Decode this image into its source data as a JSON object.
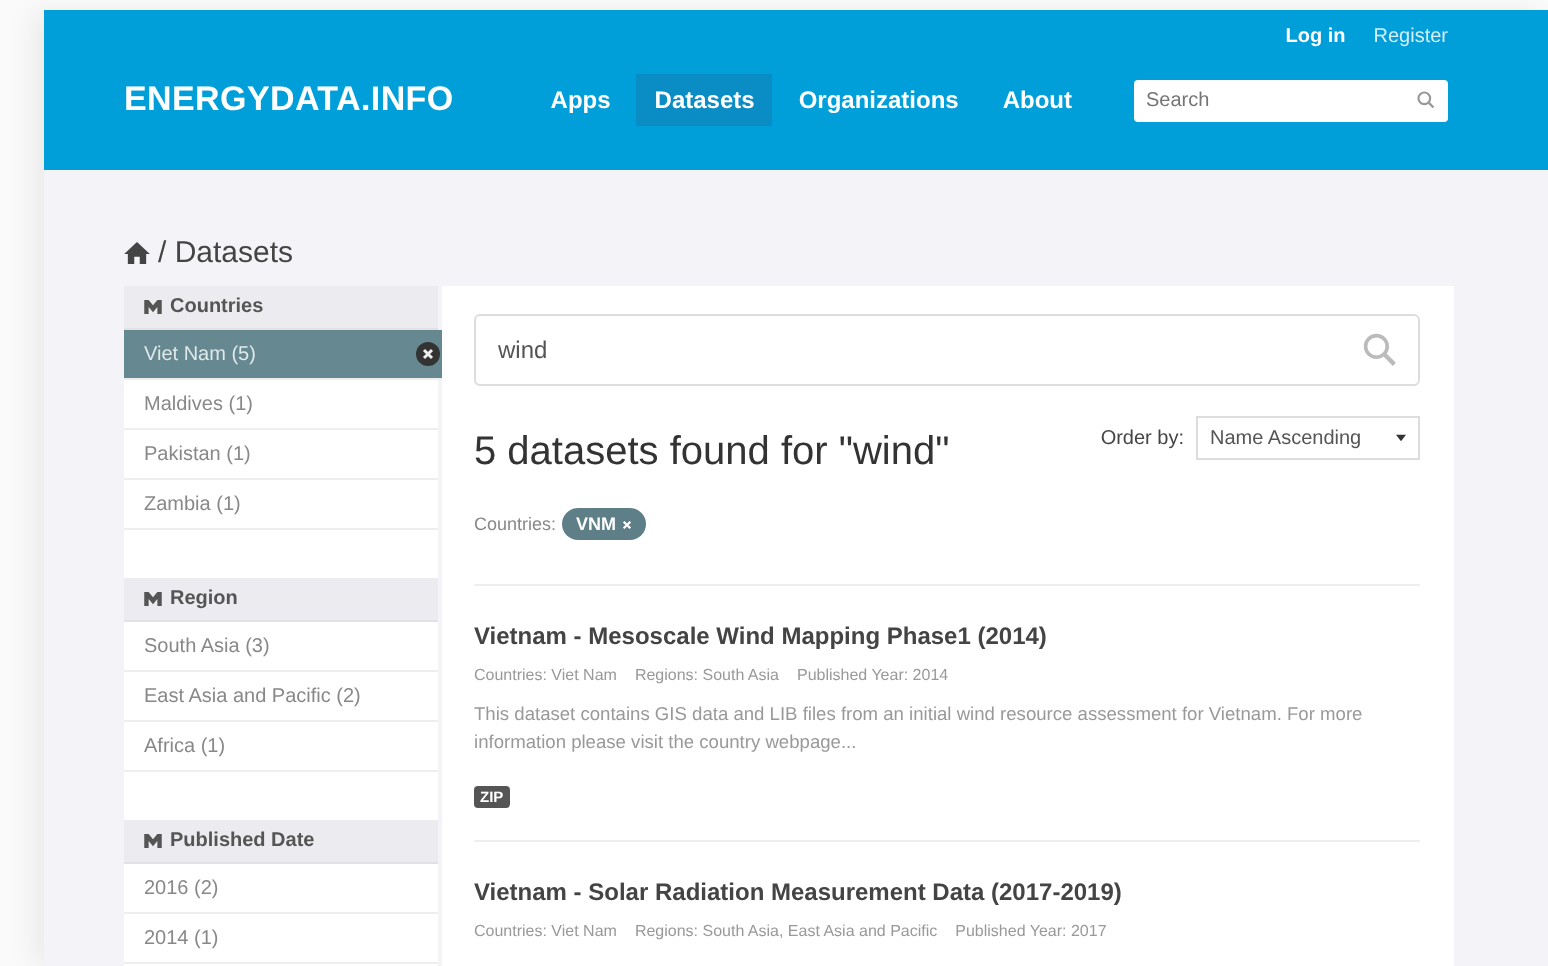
{
  "header": {
    "brand": "ENERGYDATA.INFO",
    "account_links": [
      "Log in",
      "Register"
    ],
    "nav": [
      {
        "label": "Apps",
        "selected": false
      },
      {
        "label": "Datasets",
        "selected": true
      },
      {
        "label": "Organizations",
        "selected": false
      },
      {
        "label": "About",
        "selected": false
      }
    ],
    "search": {
      "placeholder": "Search"
    }
  },
  "breadcrumb": "/ Datasets",
  "facets": [
    {
      "title": "Countries",
      "items": [
        {
          "label": "Viet Nam (5)",
          "selected": true
        },
        {
          "label": "Maldives (1)",
          "selected": false
        },
        {
          "label": "Pakistan (1)",
          "selected": false
        },
        {
          "label": "Zambia (1)",
          "selected": false
        }
      ]
    },
    {
      "title": "Region",
      "items": [
        {
          "label": "South Asia (3)",
          "selected": false
        },
        {
          "label": "East Asia and Pacific (2)",
          "selected": false
        },
        {
          "label": "Africa (1)",
          "selected": false
        }
      ]
    },
    {
      "title": "Published Date",
      "items": [
        {
          "label": "2016 (2)",
          "selected": false
        },
        {
          "label": "2014 (1)",
          "selected": false
        }
      ]
    }
  ],
  "query": {
    "value": "wind"
  },
  "results_heading": "5 datasets found for \"wind\"",
  "order_by": {
    "label": "Order by:",
    "value": "Name Ascending"
  },
  "filters": {
    "label": "Countries:",
    "pills": [
      "VNM"
    ]
  },
  "datasets": [
    {
      "title": "Vietnam - Mesoscale Wind Mapping Phase1 (2014)",
      "meta": [
        "Countries: Viet Nam",
        "Regions: South Asia",
        "Published Year: 2014"
      ],
      "description": "This dataset contains GIS data and LIB files from an initial wind resource assessment for Vietnam. For more information please visit the country webpage...",
      "formats": [
        "ZIP"
      ]
    },
    {
      "title": "Vietnam - Solar Radiation Measurement Data (2017-2019)",
      "meta": [
        "Countries: Viet Nam",
        "Regions: South Asia, East Asia and Pacific",
        "Published Year: 2017"
      ]
    }
  ]
}
